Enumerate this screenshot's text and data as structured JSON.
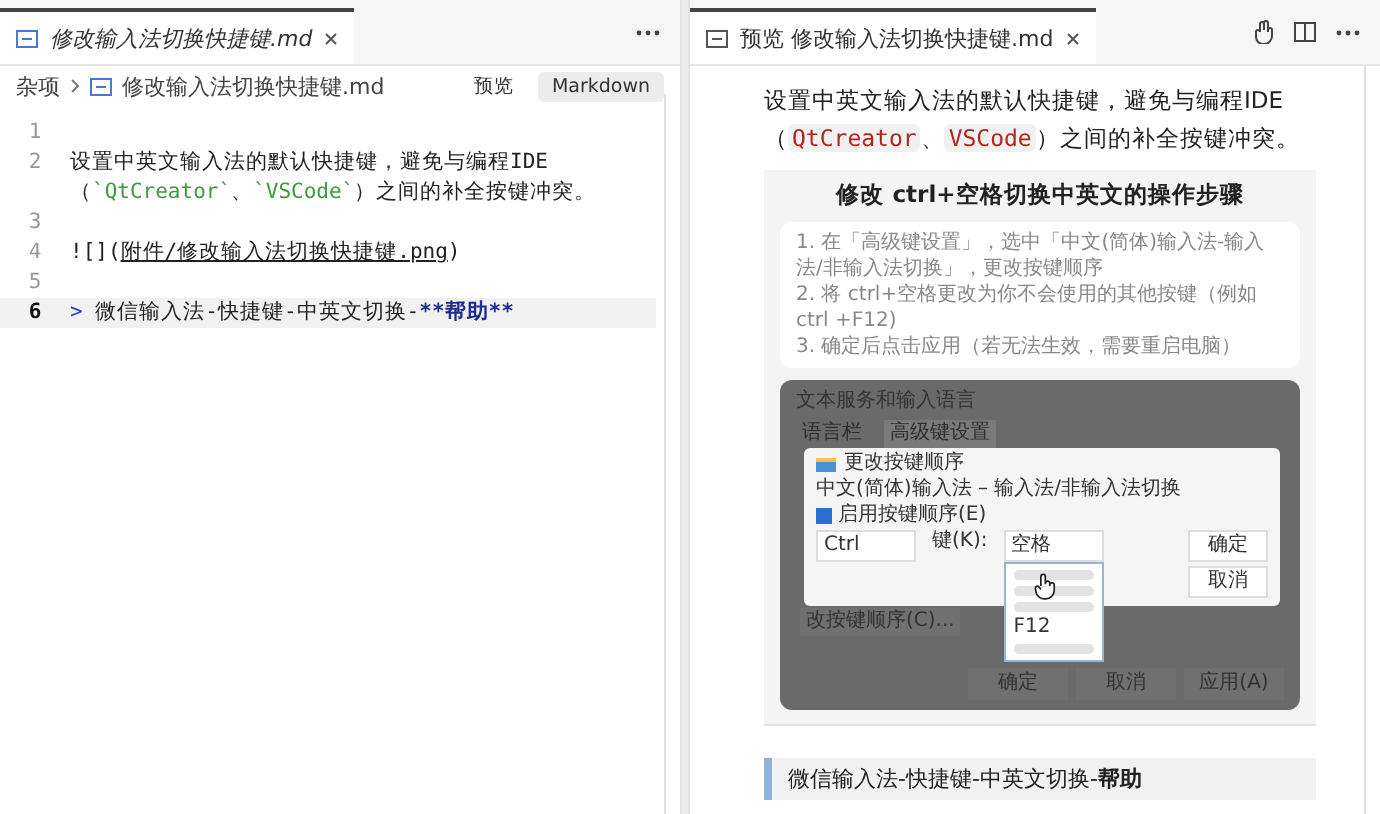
{
  "editor": {
    "tab": {
      "title": "修改输入法切换快捷键.md",
      "selected": true
    },
    "breadcrumb": [
      "杂项",
      "修改输入法切换快捷键.md"
    ],
    "mode_buttons": [
      {
        "label": "预览",
        "selected": false
      },
      {
        "label": "Markdown",
        "selected": true
      }
    ],
    "lines": [
      {
        "number": "1",
        "current": false
      },
      {
        "number": "2",
        "current": false,
        "segments": [
          {
            "kind": "text",
            "text": "设置中英文输入法的默认快捷键，避免与编程IDE（"
          },
          {
            "kind": "code",
            "text": "`QtCreator`"
          },
          {
            "kind": "text",
            "text": "、"
          },
          {
            "kind": "code",
            "text": "`VSCode`"
          },
          {
            "kind": "text",
            "text": "）之间的补全按键冲突。"
          }
        ]
      },
      {
        "number": "3",
        "current": false
      },
      {
        "number": "4",
        "current": false,
        "segments": [
          {
            "kind": "text",
            "text": "![]("
          },
          {
            "kind": "link",
            "text": "附件/修改输入法切换快捷键.png"
          },
          {
            "kind": "text",
            "text": ")"
          }
        ]
      },
      {
        "number": "5",
        "current": false
      },
      {
        "number": "6",
        "current": true,
        "segments": [
          {
            "kind": "quote",
            "text": ">"
          },
          {
            "kind": "text",
            "text": " 微信输入法-快捷键-中英文切换-"
          },
          {
            "kind": "bold",
            "text": "**帮助**"
          }
        ]
      }
    ]
  },
  "preview": {
    "tab": {
      "title": "预览 修改输入法切换快捷键.md",
      "selected": true
    },
    "paragraph": [
      {
        "kind": "text",
        "text": "设置中英文输入法的默认快捷键，避免与编程IDE（"
      },
      {
        "kind": "code",
        "text": "QtCreator"
      },
      {
        "kind": "text",
        "text": "、"
      },
      {
        "kind": "code",
        "text": "VSCode"
      },
      {
        "kind": "text",
        "text": "）之间的补全按键冲突。"
      }
    ],
    "image": {
      "title": "修改 ctrl+空格切换中英文的操作步骤",
      "steps": [
        "1. 在「高级键设置」，选中「中文(简体)输入法-输入法/非输入法切换」，更改按键顺序",
        "2. 将 ctrl+空格更改为你不会使用的其他按键（例如 ctrl +F12)",
        "3. 确定后点击应用（若无法生效，需要重启电脑）"
      ],
      "back_dialog": {
        "title": "文本服务和输入语言",
        "tabs": [
          {
            "label": "语言栏",
            "selected": false
          },
          {
            "label": "高级键设置",
            "selected": true
          }
        ],
        "change_button": "改按键顺序(C)...",
        "buttons": [
          "确定",
          "取消",
          "应用(A)"
        ]
      },
      "front_dialog": {
        "title": "更改按键顺序",
        "label": "中文(简体)输入法 – 输入法/非输入法切换",
        "checkbox": {
          "label": "启用按键顺序(E)",
          "checked": true
        },
        "modifier": "Ctrl",
        "key_label": "键(K):",
        "key": "空格",
        "buttons": [
          "确定",
          "取消"
        ],
        "options": [
          {
            "kind": "blurred"
          },
          {
            "kind": "blurred"
          },
          {
            "kind": "blurred"
          },
          {
            "kind": "text",
            "text": "F12"
          },
          {
            "kind": "blurred"
          }
        ]
      }
    },
    "quote": "微信输入法-快捷键-中英文切换-**帮助**"
  }
}
